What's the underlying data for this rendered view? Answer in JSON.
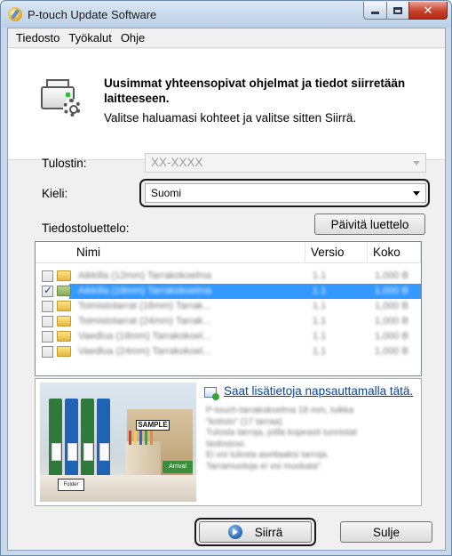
{
  "window": {
    "title": "P-touch Update Software",
    "controls": {
      "minimize": "",
      "maximize": "",
      "close": "✕"
    }
  },
  "menu": {
    "items": [
      "Tiedosto",
      "Työkalut",
      "Ohje"
    ]
  },
  "header": {
    "bold_text": "Uusimmat yhteensopivat ohjelmat ja tiedot siirretään laitteeseen.",
    "sub_text": "Valitse haluamasi kohteet ja valitse sitten Siirrä.",
    "icon": "printer-gear-icon"
  },
  "form": {
    "printer_label": "Tulostin:",
    "printer_value": "XX-XXXX",
    "language_label": "Kieli:",
    "language_value": "Suomi",
    "file_list_label": "Tiedostoluettelo:",
    "refresh_button": "Päivitä luettelo"
  },
  "file_list": {
    "columns": [
      "Nimi",
      "Versio",
      "Koko"
    ],
    "rows": [
      {
        "checked": false,
        "selected": false,
        "folder": "yellow",
        "name": "Aikkilla (12mm) Tarrakokoelma",
        "version": "1.1",
        "size": "1,000 B"
      },
      {
        "checked": true,
        "selected": true,
        "folder": "green",
        "name": "Aikkilla (18mm) Tarrakokoelma",
        "version": "1.1",
        "size": "1,000 B"
      },
      {
        "checked": false,
        "selected": false,
        "folder": "yellow",
        "name": "Toimistotarrat (18mm) Tarrak...",
        "version": "1.1",
        "size": "1,000 B"
      },
      {
        "checked": false,
        "selected": false,
        "folder": "yellow",
        "name": "Toimistotarrat (24mm) Tarrak...",
        "version": "1.1",
        "size": "1,000 B"
      },
      {
        "checked": false,
        "selected": false,
        "folder": "yellow",
        "name": "Vaedlua (18mm) Tarrakokoel...",
        "version": "1.1",
        "size": "1,000 B"
      },
      {
        "checked": false,
        "selected": false,
        "folder": "yellow",
        "name": "Vaedlua (24mm) Tarrakokoel...",
        "version": "1.1",
        "size": "1,000 B"
      }
    ]
  },
  "info_panel": {
    "link_text": "Saat lisätietoja napsauttamalla tätä.",
    "lines": [
      "P-touch-tarrakokoelma 18 mm, tuikka",
      "\"kotisto\" (17 tarraa).",
      "Tulosta tarroja, joilla kopeasti tunnistat",
      "tiedostosi.",
      "Ei voi tulosta asettaaksi tarroja.",
      "Tarramuotoja ei voi muokata\"."
    ],
    "photo_label": "SAMPLE",
    "photo_tag": "Arrival",
    "photo_card": "Folder"
  },
  "buttons": {
    "transfer": "Siirrä",
    "close": "Sulje"
  }
}
